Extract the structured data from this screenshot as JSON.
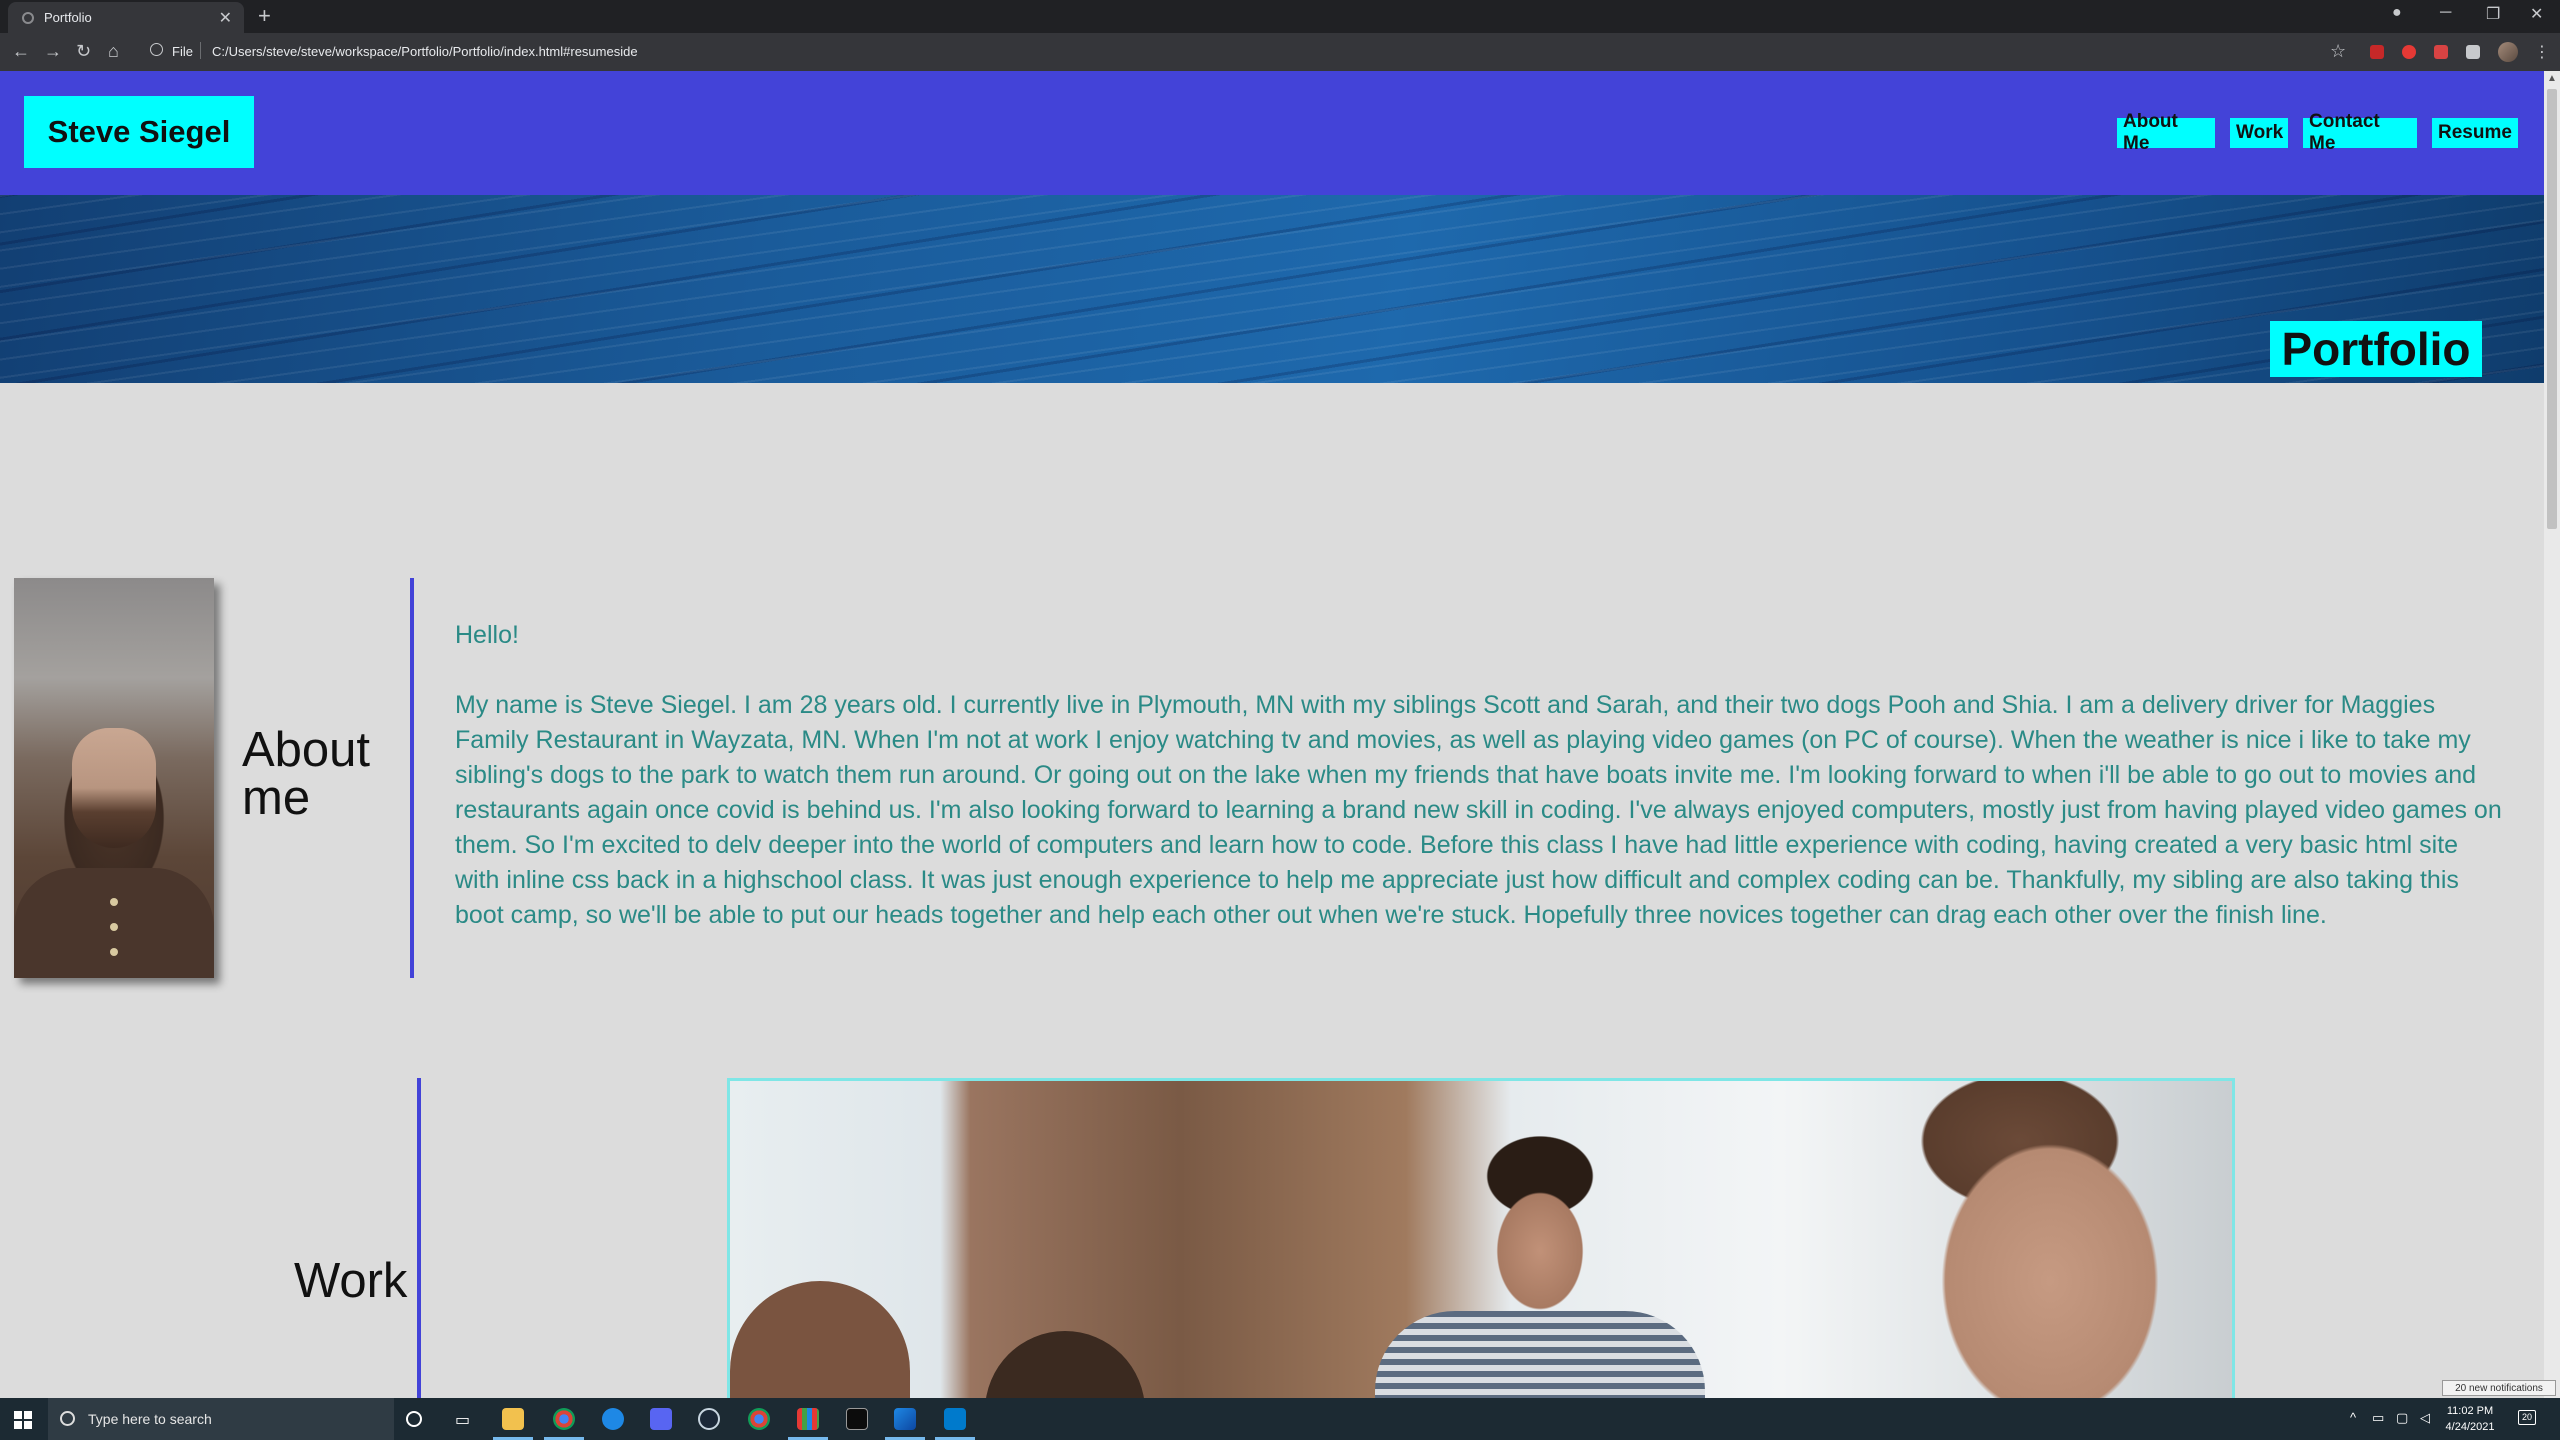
{
  "browser": {
    "tab_title": "Portfolio",
    "tab_close": "✕",
    "new_tab": "+",
    "omnibox_scheme": "File",
    "url": "C:/Users/steve/steve/workspace/Portfolio/Portfolio/index.html#resumeside",
    "icons": [
      "back-icon",
      "forward-icon",
      "reload-icon",
      "home-icon",
      "info-icon",
      "star-icon",
      "extensions-icon",
      "menu-icon"
    ]
  },
  "site": {
    "brand": "Steve Siegel",
    "nav": [
      "About Me",
      "Work",
      "Contact Me",
      "Resume"
    ],
    "hero_title": "Portfolio",
    "colors": {
      "header": "#4343d8",
      "accent": "#00ffff",
      "body_text": "#2a8a86",
      "background": "#dcdcdc"
    }
  },
  "about": {
    "heading": "About me",
    "greeting": "Hello!",
    "bio": "My name is Steve Siegel. I am 28 years old. I currently live in Plymouth, MN with my siblings Scott and Sarah, and their two dogs Pooh and Shia. I am a delivery driver for Maggies Family Restaurant in Wayzata, MN. When I'm not at work I enjoy watching tv and movies, as well as playing video games (on PC of course). When the weather is nice i like to take my sibling's dogs to the park to watch them run around. Or going out on the lake when my friends that have boats invite me. I'm looking forward to when i'll be able to go out to movies and restaurants again once covid is behind us. I'm also looking forward to learning a brand new skill in coding. I've always enjoyed computers, mostly just from having played video games on them. So I'm excited to delv deeper into the world of computers and learn how to code. Before this class I have had little experience with coding, having created a very basic html site with inline css back in a highschool class. It was just enough experience to help me appreciate just how difficult and complex coding can be. Thankfully, my sibling are also taking this boot camp, so we'll be able to put our heads together and help each other out when we're stuck. Hopefully three novices together can drag each other over the finish line."
  },
  "work": {
    "heading": "Work"
  },
  "notification_toast": "20 new notifications",
  "taskbar": {
    "search_placeholder": "Type here to search",
    "time": "11:02 PM",
    "date": "4/24/2021",
    "action_center_count": "20",
    "apps": [
      "file-explorer",
      "chrome",
      "edge",
      "discord",
      "steam",
      "chrome-alt",
      "app-grid",
      "terminal",
      "paint",
      "vscode"
    ]
  }
}
